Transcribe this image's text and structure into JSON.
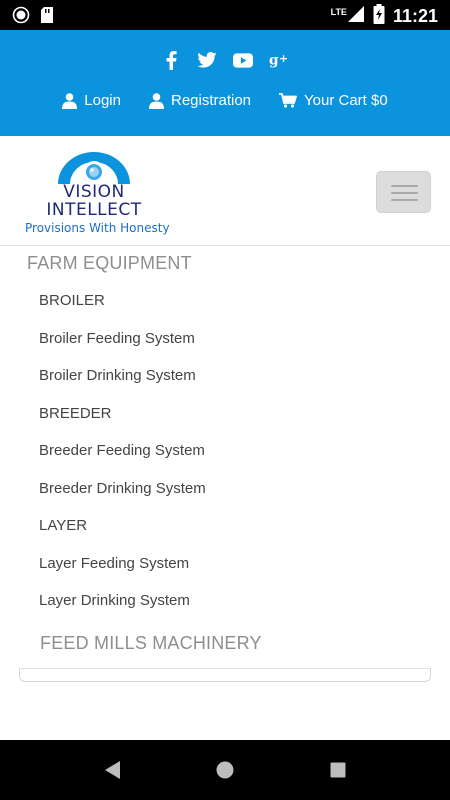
{
  "status_bar": {
    "time": "11:21",
    "network": "LTE",
    "icons": [
      "notification-circle-icon",
      "sd-card-icon",
      "lte-signal-icon",
      "battery-charging-icon"
    ]
  },
  "header": {
    "social_icons": [
      "facebook-icon",
      "twitter-icon",
      "youtube-icon",
      "google-plus-icon"
    ],
    "login_label": "Login",
    "registration_label": "Registration",
    "cart_label": "Your Cart $0",
    "background_color": "#0b94dd"
  },
  "brand": {
    "line1": "VISION",
    "line2": "INTELLECT",
    "tagline": "Provisions With Honesty",
    "text_color": "#1e2a78",
    "accent_color": "#0b94dd"
  },
  "menu": {
    "category_1": "FARM EQUIPMENT",
    "items": [
      "BROILER",
      "Broiler Feeding System",
      "Broiler Drinking System",
      "BREEDER",
      "Breeder Feeding System",
      "Breeder Drinking System",
      "LAYER",
      "Layer Feeding System",
      "Layer Drinking System"
    ],
    "category_2": "FEED MILLS MACHINERY"
  },
  "nav_bar": {
    "buttons": [
      "back-icon",
      "home-icon",
      "recents-icon"
    ]
  }
}
